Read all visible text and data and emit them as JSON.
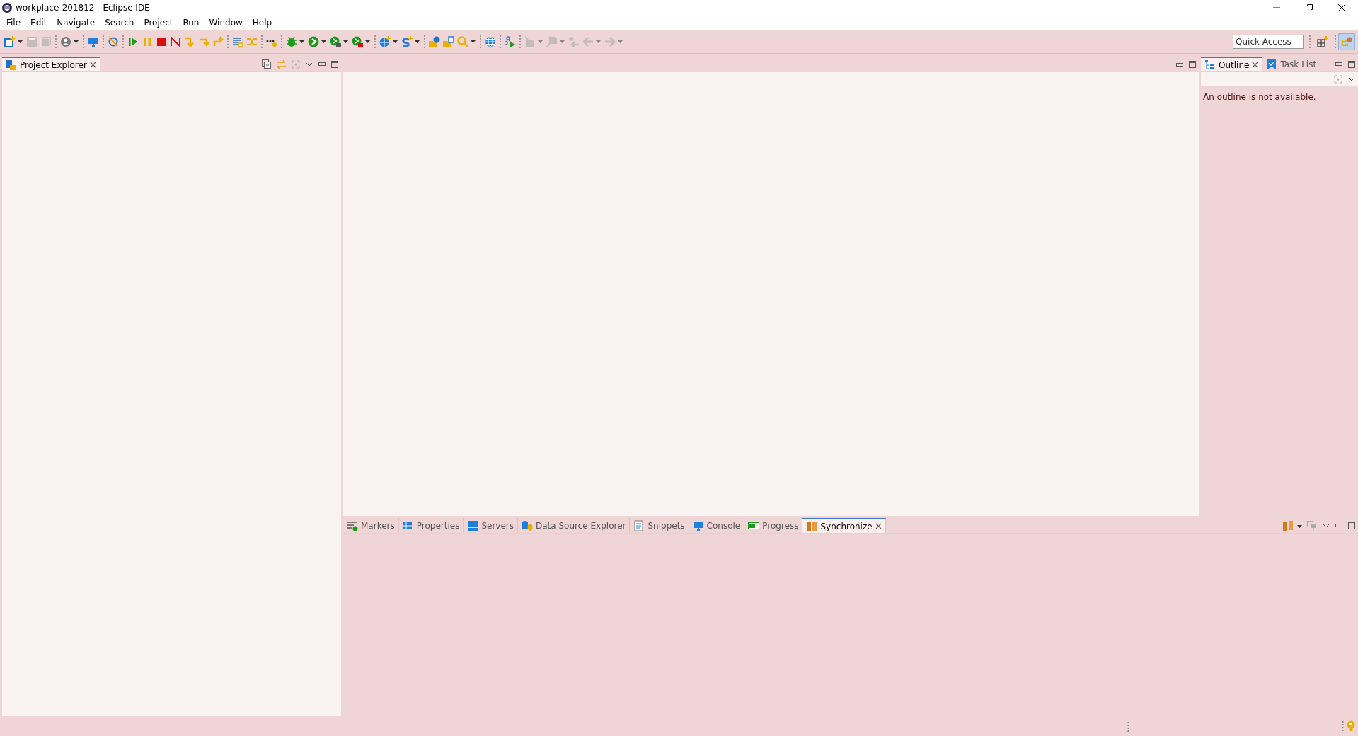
{
  "window": {
    "title": "workplace-201812 - Eclipse IDE"
  },
  "menu": [
    "File",
    "Edit",
    "Navigate",
    "Search",
    "Project",
    "Run",
    "Window",
    "Help"
  ],
  "toolbar": [
    {
      "kind": "new",
      "dropdown": true,
      "disabled": false
    },
    {
      "kind": "save",
      "dropdown": false,
      "disabled": true
    },
    {
      "kind": "saveall",
      "dropdown": false,
      "disabled": true
    },
    {
      "kind": "sep"
    },
    {
      "kind": "person",
      "dropdown": true,
      "disabled": false
    },
    {
      "kind": "sep"
    },
    {
      "kind": "monitor",
      "dropdown": false,
      "disabled": false
    },
    {
      "kind": "sep"
    },
    {
      "kind": "skip",
      "dropdown": false,
      "disabled": false
    },
    {
      "kind": "sep"
    },
    {
      "kind": "resume",
      "dropdown": false,
      "disabled": false
    },
    {
      "kind": "suspend",
      "dropdown": false,
      "disabled": false
    },
    {
      "kind": "terminate",
      "dropdown": false,
      "disabled": false
    },
    {
      "kind": "disconnect",
      "dropdown": false,
      "disabled": false
    },
    {
      "kind": "stepin",
      "dropdown": false,
      "disabled": false
    },
    {
      "kind": "stepover",
      "dropdown": false,
      "disabled": false
    },
    {
      "kind": "stepret",
      "dropdown": false,
      "disabled": false
    },
    {
      "kind": "sep"
    },
    {
      "kind": "lines",
      "dropdown": false,
      "disabled": false
    },
    {
      "kind": "shuffle",
      "dropdown": false,
      "disabled": false
    },
    {
      "kind": "sep"
    },
    {
      "kind": "dots",
      "dropdown": false,
      "disabled": false
    },
    {
      "kind": "sep"
    },
    {
      "kind": "bug",
      "dropdown": true,
      "disabled": false
    },
    {
      "kind": "run",
      "dropdown": true,
      "disabled": false
    },
    {
      "kind": "runext",
      "dropdown": true,
      "disabled": false
    },
    {
      "kind": "coverage",
      "dropdown": true,
      "disabled": false
    },
    {
      "kind": "sep"
    },
    {
      "kind": "globeplus",
      "dropdown": true,
      "disabled": false
    },
    {
      "kind": "splus",
      "dropdown": true,
      "disabled": false
    },
    {
      "kind": "sep"
    },
    {
      "kind": "folderball",
      "dropdown": false,
      "disabled": false
    },
    {
      "kind": "folderclip",
      "dropdown": false,
      "disabled": false
    },
    {
      "kind": "search",
      "dropdown": true,
      "disabled": false
    },
    {
      "kind": "sep"
    },
    {
      "kind": "globe",
      "dropdown": false,
      "disabled": false
    },
    {
      "kind": "sep"
    },
    {
      "kind": "graph",
      "dropdown": false,
      "disabled": false
    },
    {
      "kind": "sep"
    },
    {
      "kind": "annot",
      "dropdown": true,
      "disabled": true
    },
    {
      "kind": "editlast",
      "dropdown": true,
      "disabled": true
    },
    {
      "kind": "backloc",
      "dropdown": false,
      "disabled": true
    },
    {
      "kind": "back",
      "dropdown": true,
      "disabled": true
    },
    {
      "kind": "forward",
      "dropdown": true,
      "disabled": true
    }
  ],
  "quick_access": {
    "placeholder": "Quick Access"
  },
  "perspective": {
    "selected": true
  },
  "left_panel": {
    "tabs": [
      {
        "label": "Project Explorer",
        "kind": "explorer",
        "selected": true,
        "closable": true
      }
    ]
  },
  "right_panel": {
    "tabs": [
      {
        "label": "Outline",
        "kind": "outline",
        "selected": true,
        "closable": true
      },
      {
        "label": "Task List",
        "kind": "tasks",
        "selected": false,
        "closable": false
      }
    ],
    "message": "An outline is not available."
  },
  "bottom_panel": {
    "tabs": [
      {
        "label": "Markers",
        "kind": "markers",
        "selected": false,
        "closable": false
      },
      {
        "label": "Properties",
        "kind": "props",
        "selected": false,
        "closable": false
      },
      {
        "label": "Servers",
        "kind": "servers",
        "selected": false,
        "closable": false
      },
      {
        "label": "Data Source Explorer",
        "kind": "dse",
        "selected": false,
        "closable": false
      },
      {
        "label": "Snippets",
        "kind": "snippets",
        "selected": false,
        "closable": false
      },
      {
        "label": "Console",
        "kind": "monitor",
        "selected": false,
        "closable": false
      },
      {
        "label": "Progress",
        "kind": "progress",
        "selected": false,
        "closable": false
      },
      {
        "label": "Synchronize",
        "kind": "sync",
        "selected": true,
        "closable": true
      }
    ]
  }
}
